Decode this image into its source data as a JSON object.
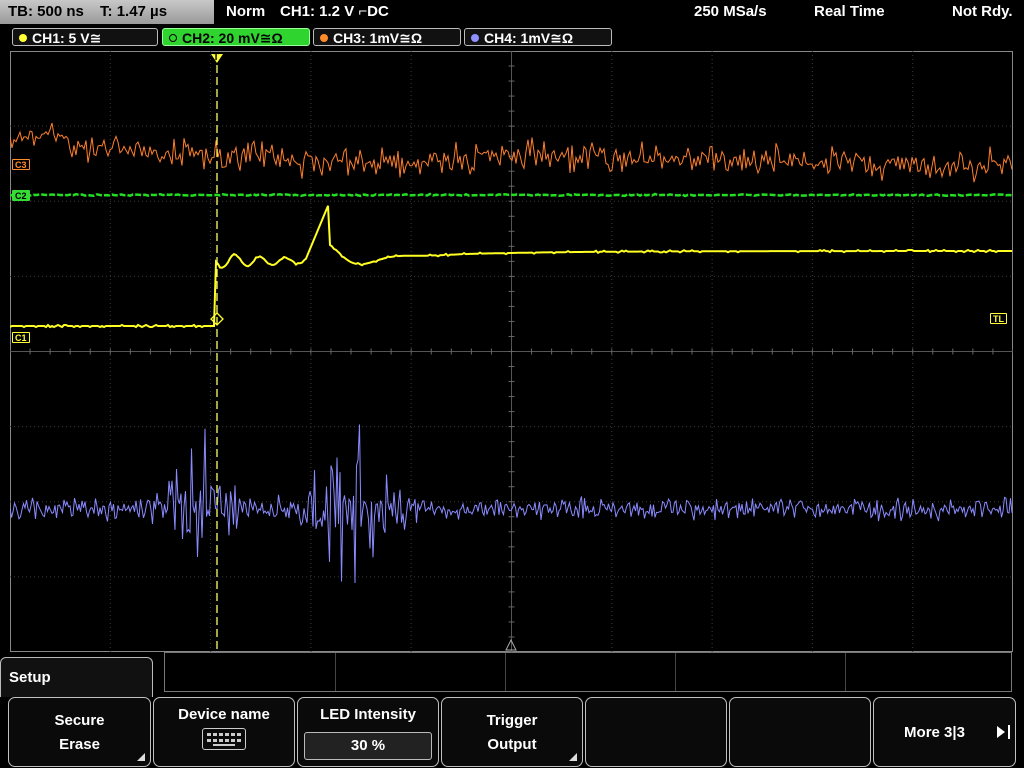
{
  "header": {
    "timebase": "TB: 500 ns",
    "trigger_time": "T: 1.47 µs",
    "mode": "Norm",
    "trigger_info": "CH1: 1.2 V ⌐DC",
    "sample_rate": "250 MSa/s",
    "acq_mode": "Real Time",
    "state": "Not Rdy."
  },
  "channels": [
    {
      "label": "CH1: 5 V≅",
      "color": "#ffff33",
      "active": false
    },
    {
      "label": "CH2: 20 mV≅Ω",
      "color": "#33dd33",
      "active": true
    },
    {
      "label": "CH3: 1mV≅Ω",
      "color": "#ff8c2a",
      "active": false
    },
    {
      "label": "CH4: 1mV≅Ω",
      "color": "#8f8fff",
      "active": false
    }
  ],
  "waveform_labels": {
    "c3": "C3",
    "c2": "C2",
    "c1": "C1",
    "trigger_level": "TL",
    "trigger_marker": "T"
  },
  "menu": {
    "title": "Setup",
    "softkeys": [
      {
        "line1": "Secure",
        "line2": "Erase"
      },
      {
        "line1": "Device name",
        "icon": "keyboard-icon"
      },
      {
        "line1": "LED Intensity",
        "value": "30 %"
      },
      {
        "line1": "Trigger",
        "line2": "Output"
      },
      {
        "line1": ""
      },
      {
        "line1": ""
      },
      {
        "line1": "More 3|3"
      }
    ]
  }
}
